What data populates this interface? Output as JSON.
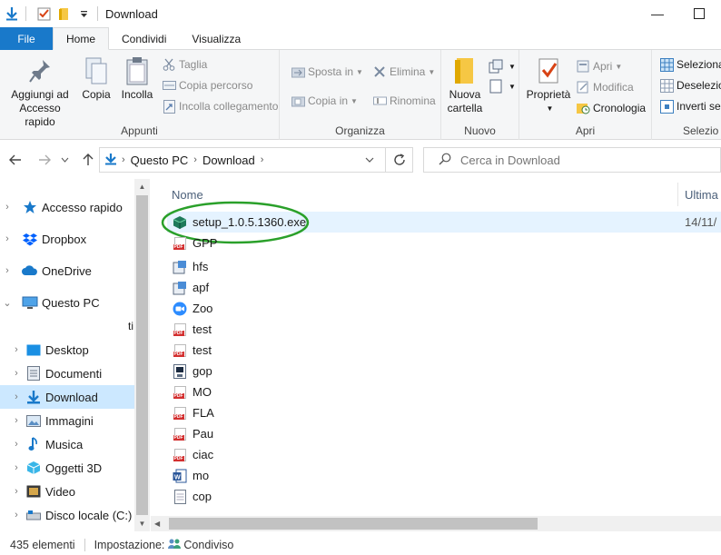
{
  "window": {
    "title": "Download",
    "minimize_symbol": "—",
    "maximize_symbol": "☐"
  },
  "ribbon_tabs": [
    {
      "label": "File"
    },
    {
      "label": "Home"
    },
    {
      "label": "Condividi"
    },
    {
      "label": "Visualizza"
    }
  ],
  "ribbon": {
    "appunti": {
      "label": "Appunti",
      "pin_label_1": "Aggiungi ad",
      "pin_label_2": "Accesso rapido",
      "copy": "Copia",
      "paste": "Incolla",
      "cut": "Taglia",
      "copy_path": "Copia percorso",
      "paste_link": "Incolla collegamento"
    },
    "organizza": {
      "label": "Organizza",
      "move_to": "Sposta in",
      "copy_to": "Copia in",
      "delete": "Elimina",
      "rename": "Rinomina"
    },
    "nuovo": {
      "label": "Nuovo",
      "new_folder_1": "Nuova",
      "new_folder_2": "cartella"
    },
    "apri": {
      "label": "Apri",
      "properties": "Proprietà",
      "open": "Apri",
      "edit": "Modifica",
      "history": "Cronologia"
    },
    "seleziona": {
      "label": "Selezio",
      "select_all": "Seleziona",
      "deselect": "Deselezio",
      "invert": "Inverti sel"
    }
  },
  "address_bar": {
    "crumbs": [
      "Questo PC",
      "Download"
    ],
    "search_placeholder": "Cerca in Download"
  },
  "nav_pane": {
    "items": [
      {
        "label": "Accesso rapido",
        "icon": "star-icon"
      },
      {
        "label": "Dropbox",
        "icon": "dropbox-icon"
      },
      {
        "label": "OneDrive",
        "icon": "cloud-icon"
      },
      {
        "label": "Questo PC",
        "icon": "computer-icon"
      },
      {
        "label": "Desktop",
        "icon": "desktop-icon"
      },
      {
        "label": "Documenti",
        "icon": "documents-icon"
      },
      {
        "label": "Download",
        "icon": "download-icon"
      },
      {
        "label": "Immagini",
        "icon": "pictures-icon"
      },
      {
        "label": "Musica",
        "icon": "music-icon"
      },
      {
        "label": "Oggetti 3D",
        "icon": "cube-icon"
      },
      {
        "label": "Video",
        "icon": "video-icon"
      },
      {
        "label": "Disco locale (C:)",
        "icon": "drive-icon"
      }
    ],
    "stray_char": "ti"
  },
  "file_list": {
    "col_name": "Nome",
    "col_modified": "Ultima",
    "files": [
      {
        "name": "setup_1.0.5.1360.exe",
        "date": "14/11/",
        "icon": "exe-package-icon"
      },
      {
        "name": "GPP",
        "date": "",
        "icon": "pdf-icon"
      },
      {
        "name": "hfs",
        "date": "",
        "icon": "installer-icon"
      },
      {
        "name": "apf",
        "date": "",
        "icon": "installer-icon"
      },
      {
        "name": "Zoo",
        "date": "",
        "icon": "zoom-icon"
      },
      {
        "name": "test",
        "date": "",
        "icon": "pdf-icon"
      },
      {
        "name": "test",
        "date": "",
        "icon": "pdf-icon"
      },
      {
        "name": "gop",
        "date": "",
        "icon": "disk-image-icon"
      },
      {
        "name": "MO",
        "date": "",
        "icon": "pdf-icon"
      },
      {
        "name": "FLA",
        "date": "",
        "icon": "pdf-icon"
      },
      {
        "name": "Pau",
        "date": "",
        "icon": "pdf-icon"
      },
      {
        "name": "ciac",
        "date": "",
        "icon": "pdf-icon"
      },
      {
        "name": "mo",
        "date": "",
        "icon": "word-icon"
      },
      {
        "name": "cop",
        "date": "",
        "icon": "text-file-icon"
      }
    ]
  },
  "status_bar": {
    "count": "435 elementi",
    "sharing_label": "Impostazione:",
    "sharing_value": "Condiviso"
  },
  "colors": {
    "accent": "#1979ca",
    "selection": "#cce8ff",
    "highlight_circle": "#2aa02a"
  }
}
